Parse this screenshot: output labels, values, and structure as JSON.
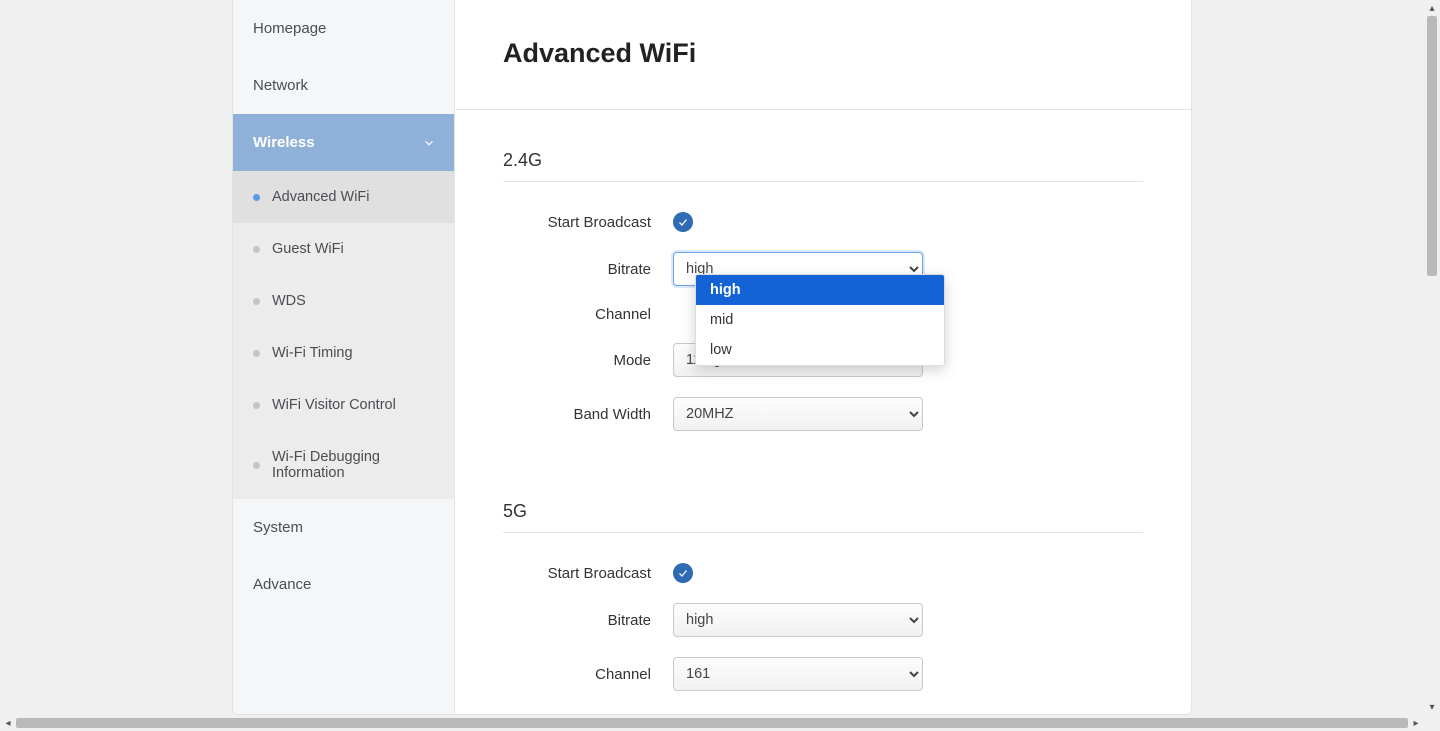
{
  "sidebar": {
    "items": [
      {
        "label": "Homepage"
      },
      {
        "label": "Network"
      },
      {
        "label": "Wireless"
      },
      {
        "label": "System"
      },
      {
        "label": "Advance"
      }
    ],
    "wireless_subitems": [
      {
        "label": "Advanced WiFi"
      },
      {
        "label": "Guest WiFi"
      },
      {
        "label": "WDS"
      },
      {
        "label": "Wi-Fi Timing"
      },
      {
        "label": "WiFi Visitor Control"
      },
      {
        "label": "Wi-Fi Debugging Information"
      }
    ]
  },
  "page": {
    "title": "Advanced WiFi"
  },
  "sections": {
    "g24": {
      "title": "2.4G",
      "start_broadcast_label": "Start Broadcast",
      "bitrate_label": "Bitrate",
      "bitrate_value": "high",
      "channel_label": "Channel",
      "mode_label": "Mode",
      "mode_value": "11n/g/b",
      "bandwidth_label": "Band Width",
      "bandwidth_value": "20MHZ"
    },
    "g5": {
      "title": "5G",
      "start_broadcast_label": "Start Broadcast",
      "bitrate_label": "Bitrate",
      "bitrate_value": "high",
      "channel_label": "Channel",
      "channel_value": "161"
    }
  },
  "bitrate_options": [
    "high",
    "mid",
    "low"
  ]
}
